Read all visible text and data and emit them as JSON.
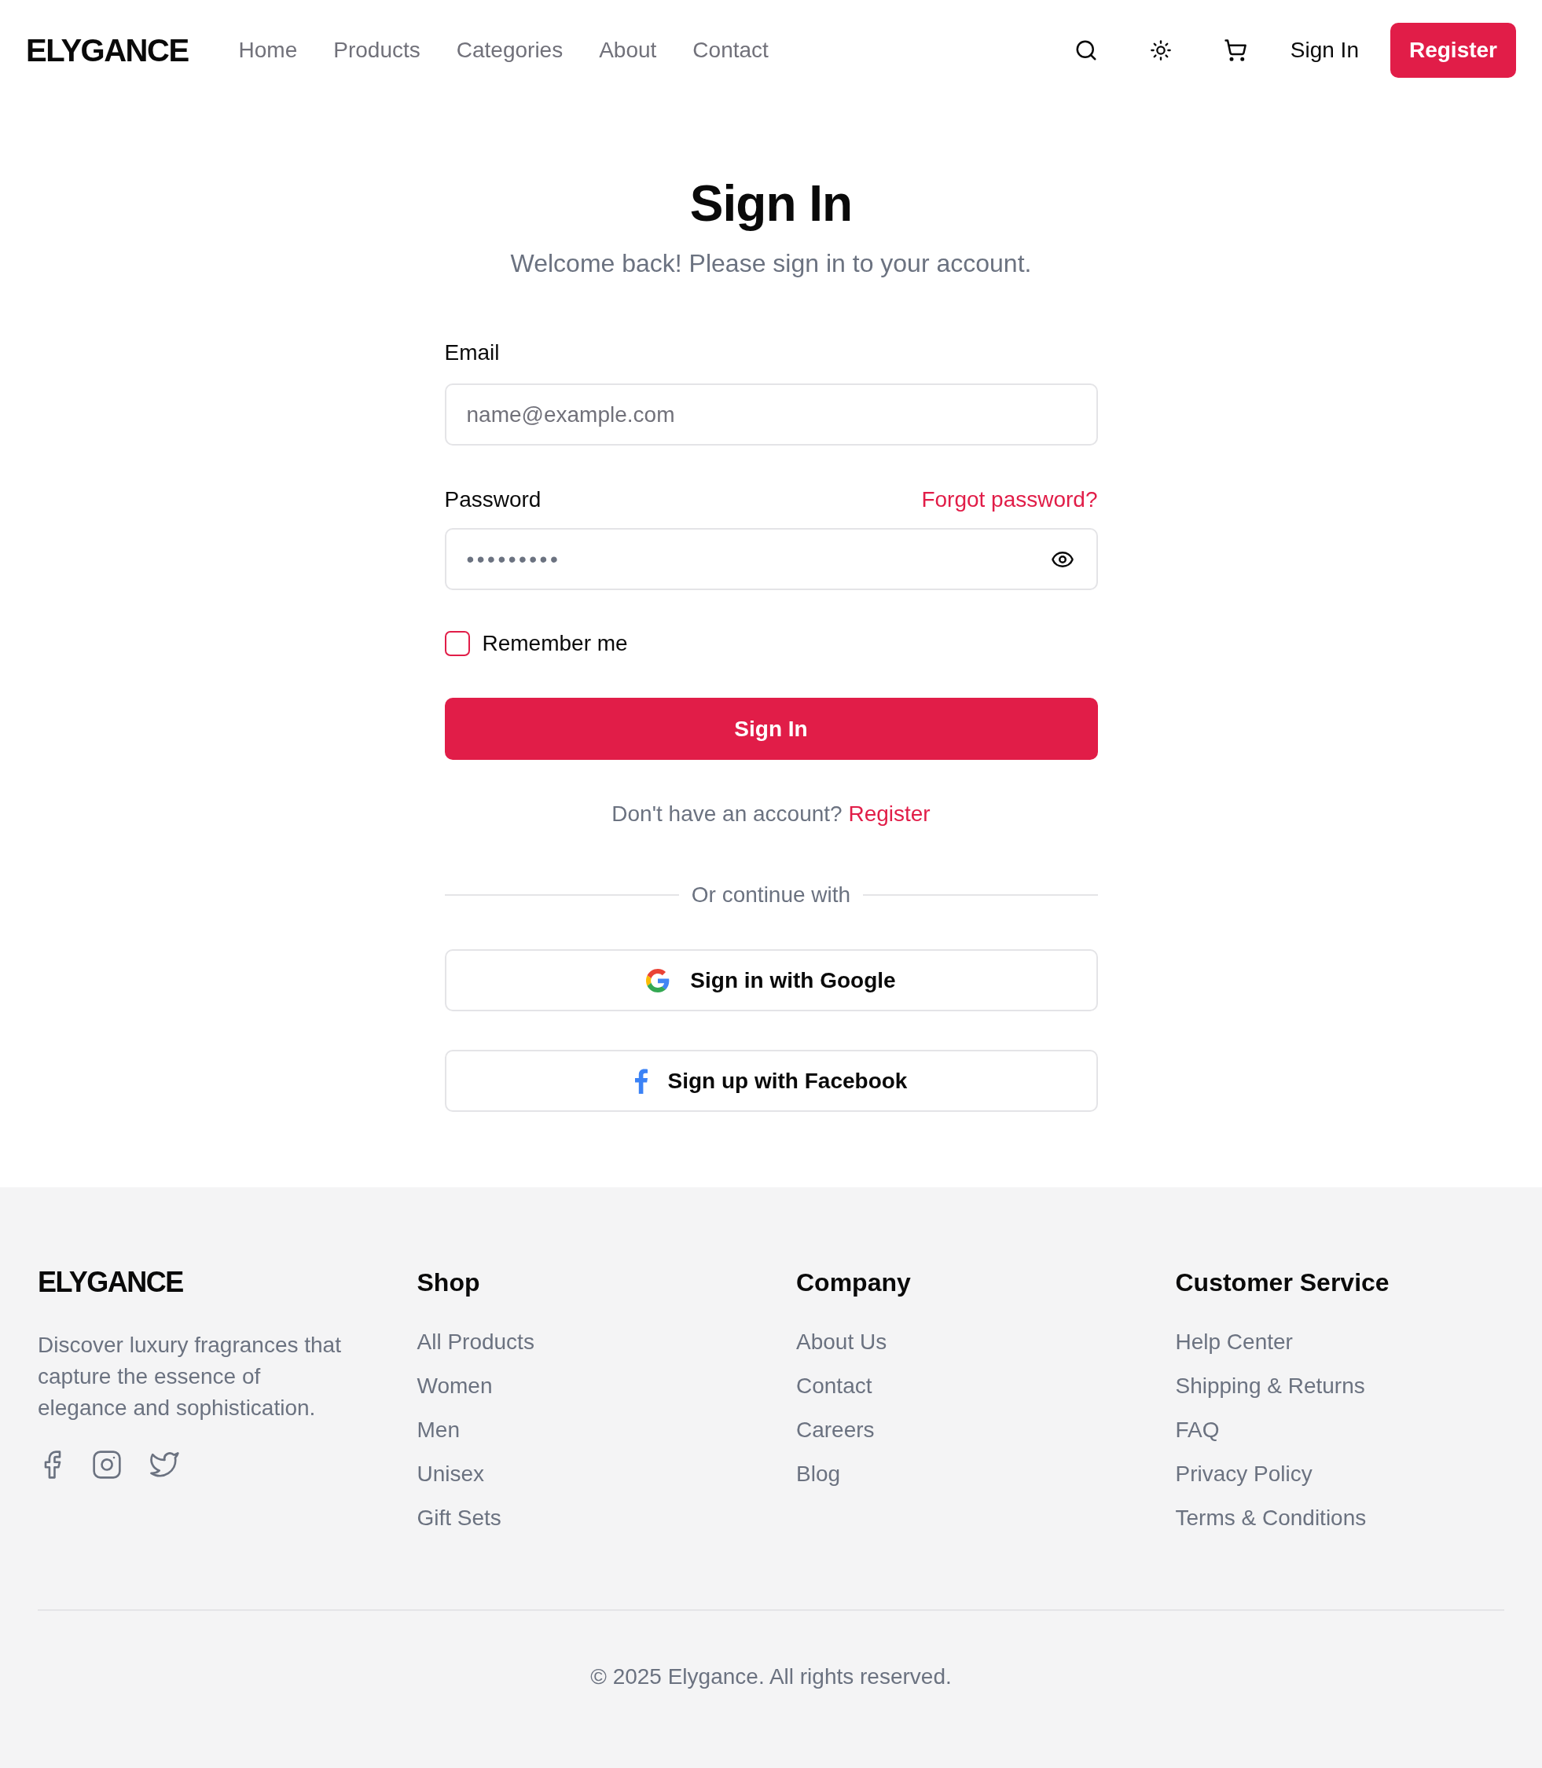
{
  "header": {
    "logo": "ELYGANCE",
    "nav": [
      {
        "label": "Home"
      },
      {
        "label": "Products"
      },
      {
        "label": "Categories"
      },
      {
        "label": "About"
      },
      {
        "label": "Contact"
      }
    ],
    "sign_in": "Sign In",
    "register": "Register"
  },
  "form": {
    "title": "Sign In",
    "subtitle": "Welcome back! Please sign in to your account.",
    "email": {
      "label": "Email",
      "placeholder": "name@example.com"
    },
    "password": {
      "label": "Password",
      "forgot": "Forgot password?",
      "value": "•••••••••"
    },
    "remember": {
      "label": "Remember me",
      "checked": false
    },
    "submit": "Sign In",
    "signup_prompt": "Don't have an account?",
    "signup_link": "Register",
    "divider": "Or continue with",
    "social": [
      {
        "kind": "google",
        "label": "Sign in with Google"
      },
      {
        "kind": "facebook",
        "label": "Sign up with Facebook"
      }
    ]
  },
  "footer": {
    "logo": "ELYGANCE",
    "description": "Discover luxury fragrances that capture the essence of elegance and sophistication.",
    "columns": [
      {
        "title": "Shop",
        "links": [
          "All Products",
          "Women",
          "Men",
          "Unisex",
          "Gift Sets"
        ]
      },
      {
        "title": "Company",
        "links": [
          "About Us",
          "Contact",
          "Careers",
          "Blog"
        ]
      },
      {
        "title": "Customer Service",
        "links": [
          "Help Center",
          "Shipping & Returns",
          "FAQ",
          "Privacy Policy",
          "Terms & Conditions"
        ]
      }
    ],
    "copyright": "© 2025 Elygance. All rights reserved."
  }
}
